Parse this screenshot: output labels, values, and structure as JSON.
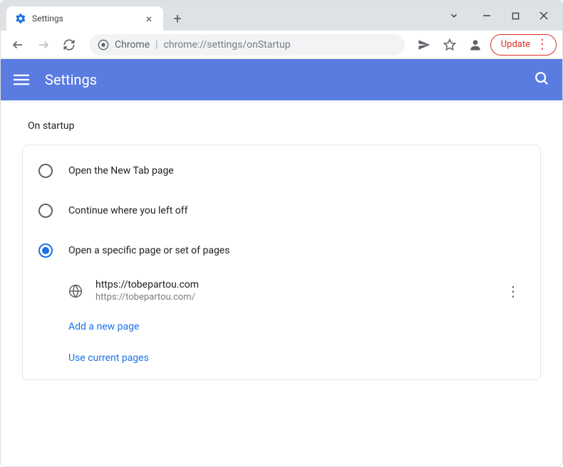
{
  "window": {
    "tab_title": "Settings"
  },
  "toolbar": {
    "chrome_label": "Chrome",
    "url": "chrome://settings/onStartup",
    "update_label": "Update"
  },
  "header": {
    "title": "Settings"
  },
  "section": {
    "label": "On startup"
  },
  "options": {
    "newtab": "Open the New Tab page",
    "continue": "Continue where you left off",
    "specific": "Open a specific page or set of pages"
  },
  "page_entry": {
    "title": "https://tobepartou.com",
    "url": "https://tobepartou.com/"
  },
  "links": {
    "add_page": "Add a new page",
    "use_current": "Use current pages"
  }
}
